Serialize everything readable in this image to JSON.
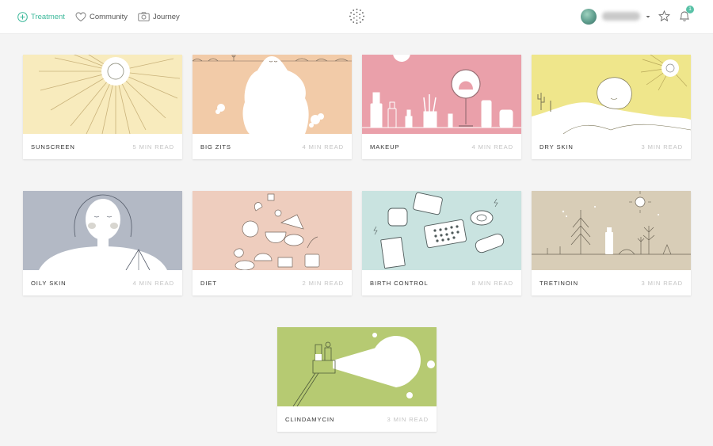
{
  "nav": {
    "items": [
      {
        "label": "Treatment",
        "icon": "plus-circle-icon",
        "active": true
      },
      {
        "label": "Community",
        "icon": "heart-icon",
        "active": false
      },
      {
        "label": "Journey",
        "icon": "camera-icon",
        "active": false
      }
    ],
    "notification_count": "1"
  },
  "colors": {
    "accent": "#3bb89a",
    "sunscreen": "#f8ebbd",
    "big_zits": "#f2cba8",
    "makeup": "#eaa0aa",
    "dry_skin": "#efe68b",
    "oily_skin": "#b3b9c5",
    "diet": "#eecdbe",
    "birth_control": "#c9e3e0",
    "tretinoin": "#d8cdb7",
    "clindamycin": "#b6ca72"
  },
  "cards": [
    {
      "title": "Sunscreen",
      "read_time": "5 min read"
    },
    {
      "title": "Big Zits",
      "read_time": "4 min read"
    },
    {
      "title": "Makeup",
      "read_time": "4 min read"
    },
    {
      "title": "Dry Skin",
      "read_time": "3 min read"
    },
    {
      "title": "Oily Skin",
      "read_time": "4 min read"
    },
    {
      "title": "Diet",
      "read_time": "2 min read"
    },
    {
      "title": "Birth Control",
      "read_time": "8 min read"
    },
    {
      "title": "Tretinoin",
      "read_time": "3 min read"
    },
    {
      "title": "Clindamycin",
      "read_time": "3 min read"
    }
  ]
}
